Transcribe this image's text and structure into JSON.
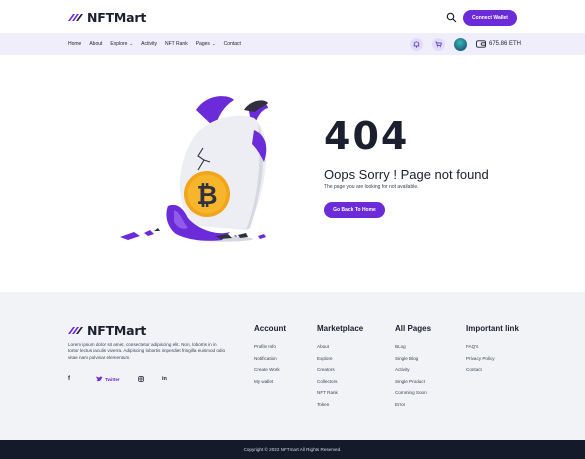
{
  "brand": {
    "name": "NFTMart",
    "accent": "#6b2bd9"
  },
  "header": {
    "connect_label": "Connect Wallet",
    "search_icon": "search-icon"
  },
  "nav": {
    "items": [
      {
        "label": "Home",
        "dropdown": false
      },
      {
        "label": "About",
        "dropdown": false
      },
      {
        "label": "Explore",
        "dropdown": true
      },
      {
        "label": "Activity",
        "dropdown": false
      },
      {
        "label": "NFT Rank",
        "dropdown": false
      },
      {
        "label": "Pages",
        "dropdown": true
      },
      {
        "label": "Contact",
        "dropdown": false
      }
    ],
    "balance": "675.86 ETH",
    "icons": [
      "bell-icon",
      "cart-icon",
      "avatar",
      "wallet-icon"
    ]
  },
  "error": {
    "code": "404",
    "title": "Oops Sorry ! Page not found",
    "subtitle": "The page you are looking for not available.",
    "button": "Go Back To Home"
  },
  "footer": {
    "description": "Lorem ipsum dolor sit amet, consectetur adipiscing elit. Non, lobortis in in tortor lectus iaculis viverra. Adipiscing lobortis imperdiet fringilla euismod odio vitae nam pulvinar elementum.",
    "social": [
      {
        "icon": "facebook-icon",
        "glyph": "f",
        "label": ""
      },
      {
        "icon": "twitter-icon",
        "glyph": "",
        "label": "Twitter"
      },
      {
        "icon": "instagram-icon",
        "glyph": "",
        "label": ""
      },
      {
        "icon": "linkedin-icon",
        "glyph": "in",
        "label": ""
      }
    ],
    "columns": [
      {
        "title": "Account",
        "links": [
          "Profile Info",
          "Notification",
          "Create Work",
          "My wallet"
        ]
      },
      {
        "title": "Marketplace",
        "links": [
          "About",
          "Explore",
          "Creators",
          "Collectors",
          "NFT Rank",
          "Token"
        ]
      },
      {
        "title": "All Pages",
        "links": [
          "BLog",
          "Single Blog",
          "Activity",
          "Single Product",
          "Comming Soon",
          "Error"
        ]
      },
      {
        "title": "Important link",
        "links": [
          "FAQ's",
          "Privacy Policy",
          "Contact"
        ]
      }
    ],
    "copyright": "Copyright © 2022 NFTmart All Rights Reserved."
  }
}
